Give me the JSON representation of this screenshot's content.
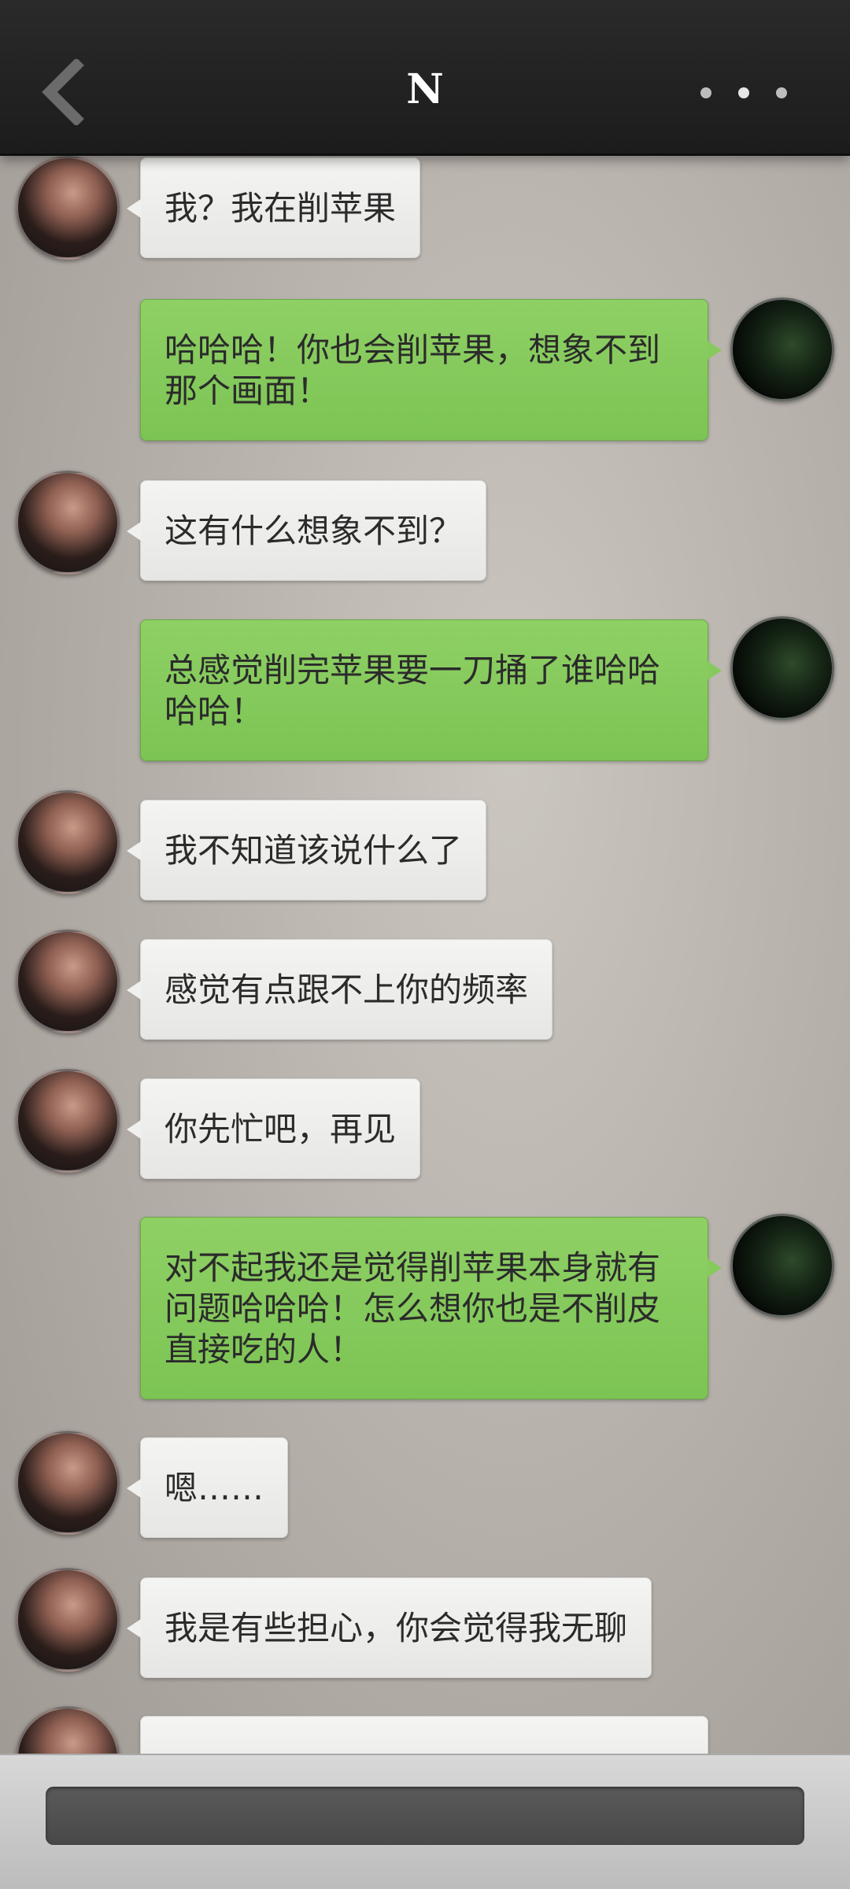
{
  "header": {
    "title": "N",
    "back_icon": "chevron-left-icon",
    "more_icon": "more-dots-icon"
  },
  "messages": [
    {
      "side": "left",
      "text": "我？我在削苹果"
    },
    {
      "side": "right",
      "text": "哈哈哈！你也会削苹果，想象不到那个画面！"
    },
    {
      "side": "left",
      "text": "这有什么想象不到？"
    },
    {
      "side": "right",
      "text": "总感觉削完苹果要一刀捅了谁哈哈哈哈！"
    },
    {
      "side": "left",
      "text": "我不知道该说什么了"
    },
    {
      "side": "left",
      "text": "感觉有点跟不上你的频率"
    },
    {
      "side": "left",
      "text": "你先忙吧，再见"
    },
    {
      "side": "right",
      "text": "对不起我还是觉得削苹果本身就有问题哈哈哈！怎么想你也是不削皮直接吃的人！"
    },
    {
      "side": "left",
      "text": "嗯……"
    },
    {
      "side": "left",
      "text": "我是有些担心，你会觉得我无聊"
    },
    {
      "side": "left",
      "text": ""
    }
  ],
  "composer": {
    "placeholder": "",
    "value": ""
  },
  "colors": {
    "header_bg": "#222222",
    "incoming_bubble": "#eeeeec",
    "outgoing_bubble": "#86c95d",
    "composer_bg": "#4f4f4f"
  }
}
